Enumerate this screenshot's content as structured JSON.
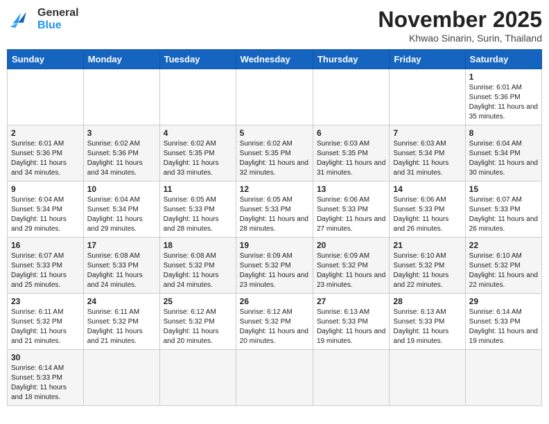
{
  "header": {
    "logo_line1": "General",
    "logo_line2": "Blue",
    "month_title": "November 2025",
    "location": "Khwao Sinarin, Surin, Thailand"
  },
  "days_of_week": [
    "Sunday",
    "Monday",
    "Tuesday",
    "Wednesday",
    "Thursday",
    "Friday",
    "Saturday"
  ],
  "weeks": [
    [
      {
        "day": "",
        "content": ""
      },
      {
        "day": "",
        "content": ""
      },
      {
        "day": "",
        "content": ""
      },
      {
        "day": "",
        "content": ""
      },
      {
        "day": "",
        "content": ""
      },
      {
        "day": "",
        "content": ""
      },
      {
        "day": "1",
        "content": "Sunrise: 6:01 AM\nSunset: 5:36 PM\nDaylight: 11 hours and 35 minutes."
      }
    ],
    [
      {
        "day": "2",
        "content": "Sunrise: 6:01 AM\nSunset: 5:36 PM\nDaylight: 11 hours and 34 minutes."
      },
      {
        "day": "3",
        "content": "Sunrise: 6:02 AM\nSunset: 5:36 PM\nDaylight: 11 hours and 34 minutes."
      },
      {
        "day": "4",
        "content": "Sunrise: 6:02 AM\nSunset: 5:35 PM\nDaylight: 11 hours and 33 minutes."
      },
      {
        "day": "5",
        "content": "Sunrise: 6:02 AM\nSunset: 5:35 PM\nDaylight: 11 hours and 32 minutes."
      },
      {
        "day": "6",
        "content": "Sunrise: 6:03 AM\nSunset: 5:35 PM\nDaylight: 11 hours and 31 minutes."
      },
      {
        "day": "7",
        "content": "Sunrise: 6:03 AM\nSunset: 5:34 PM\nDaylight: 11 hours and 31 minutes."
      },
      {
        "day": "8",
        "content": "Sunrise: 6:04 AM\nSunset: 5:34 PM\nDaylight: 11 hours and 30 minutes."
      }
    ],
    [
      {
        "day": "9",
        "content": "Sunrise: 6:04 AM\nSunset: 5:34 PM\nDaylight: 11 hours and 29 minutes."
      },
      {
        "day": "10",
        "content": "Sunrise: 6:04 AM\nSunset: 5:34 PM\nDaylight: 11 hours and 29 minutes."
      },
      {
        "day": "11",
        "content": "Sunrise: 6:05 AM\nSunset: 5:33 PM\nDaylight: 11 hours and 28 minutes."
      },
      {
        "day": "12",
        "content": "Sunrise: 6:05 AM\nSunset: 5:33 PM\nDaylight: 11 hours and 28 minutes."
      },
      {
        "day": "13",
        "content": "Sunrise: 6:06 AM\nSunset: 5:33 PM\nDaylight: 11 hours and 27 minutes."
      },
      {
        "day": "14",
        "content": "Sunrise: 6:06 AM\nSunset: 5:33 PM\nDaylight: 11 hours and 26 minutes."
      },
      {
        "day": "15",
        "content": "Sunrise: 6:07 AM\nSunset: 5:33 PM\nDaylight: 11 hours and 26 minutes."
      }
    ],
    [
      {
        "day": "16",
        "content": "Sunrise: 6:07 AM\nSunset: 5:33 PM\nDaylight: 11 hours and 25 minutes."
      },
      {
        "day": "17",
        "content": "Sunrise: 6:08 AM\nSunset: 5:33 PM\nDaylight: 11 hours and 24 minutes."
      },
      {
        "day": "18",
        "content": "Sunrise: 6:08 AM\nSunset: 5:32 PM\nDaylight: 11 hours and 24 minutes."
      },
      {
        "day": "19",
        "content": "Sunrise: 6:09 AM\nSunset: 5:32 PM\nDaylight: 11 hours and 23 minutes."
      },
      {
        "day": "20",
        "content": "Sunrise: 6:09 AM\nSunset: 5:32 PM\nDaylight: 11 hours and 23 minutes."
      },
      {
        "day": "21",
        "content": "Sunrise: 6:10 AM\nSunset: 5:32 PM\nDaylight: 11 hours and 22 minutes."
      },
      {
        "day": "22",
        "content": "Sunrise: 6:10 AM\nSunset: 5:32 PM\nDaylight: 11 hours and 22 minutes."
      }
    ],
    [
      {
        "day": "23",
        "content": "Sunrise: 6:11 AM\nSunset: 5:32 PM\nDaylight: 11 hours and 21 minutes."
      },
      {
        "day": "24",
        "content": "Sunrise: 6:11 AM\nSunset: 5:32 PM\nDaylight: 11 hours and 21 minutes."
      },
      {
        "day": "25",
        "content": "Sunrise: 6:12 AM\nSunset: 5:32 PM\nDaylight: 11 hours and 20 minutes."
      },
      {
        "day": "26",
        "content": "Sunrise: 6:12 AM\nSunset: 5:32 PM\nDaylight: 11 hours and 20 minutes."
      },
      {
        "day": "27",
        "content": "Sunrise: 6:13 AM\nSunset: 5:33 PM\nDaylight: 11 hours and 19 minutes."
      },
      {
        "day": "28",
        "content": "Sunrise: 6:13 AM\nSunset: 5:33 PM\nDaylight: 11 hours and 19 minutes."
      },
      {
        "day": "29",
        "content": "Sunrise: 6:14 AM\nSunset: 5:33 PM\nDaylight: 11 hours and 19 minutes."
      }
    ],
    [
      {
        "day": "30",
        "content": "Sunrise: 6:14 AM\nSunset: 5:33 PM\nDaylight: 11 hours and 18 minutes."
      },
      {
        "day": "",
        "content": ""
      },
      {
        "day": "",
        "content": ""
      },
      {
        "day": "",
        "content": ""
      },
      {
        "day": "",
        "content": ""
      },
      {
        "day": "",
        "content": ""
      },
      {
        "day": "",
        "content": ""
      }
    ]
  ]
}
